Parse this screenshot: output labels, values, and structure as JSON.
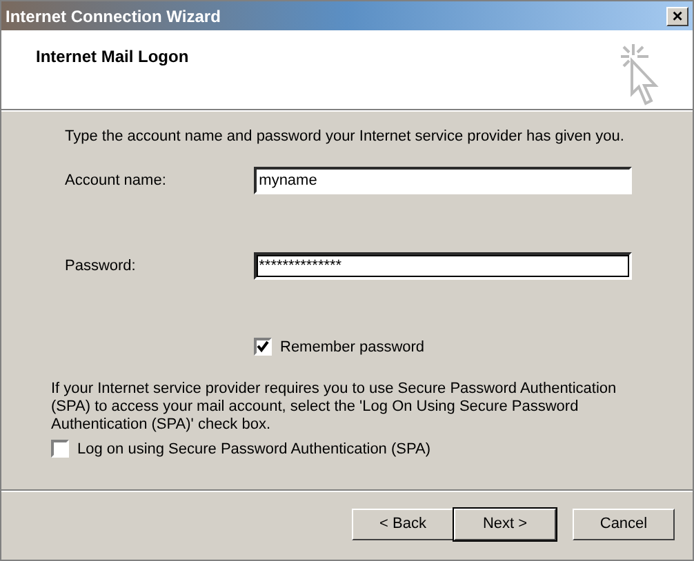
{
  "window": {
    "title": "Internet Connection Wizard",
    "close_label": "×"
  },
  "header": {
    "title": "Internet Mail Logon"
  },
  "intro": "Type the account name and password your Internet service provider has given you.",
  "fields": [
    {
      "label": "Account name:",
      "value": "myname",
      "focused": false
    },
    {
      "label": "Password:",
      "value": "**************",
      "focused": true
    }
  ],
  "remember": {
    "label": "Remember password",
    "checked": true
  },
  "spa_note": "If your Internet service provider requires you to use Secure Password Authentication (SPA) to access your mail account, select the 'Log On Using Secure Password Authentication (SPA)' check box.",
  "spa": {
    "label": "Log on using Secure Password Authentication (SPA)",
    "checked": false
  },
  "buttons": [
    {
      "label": "< Back",
      "default": false
    },
    {
      "label": "Next >",
      "default": true
    },
    {
      "label": "Cancel",
      "default": false
    }
  ]
}
